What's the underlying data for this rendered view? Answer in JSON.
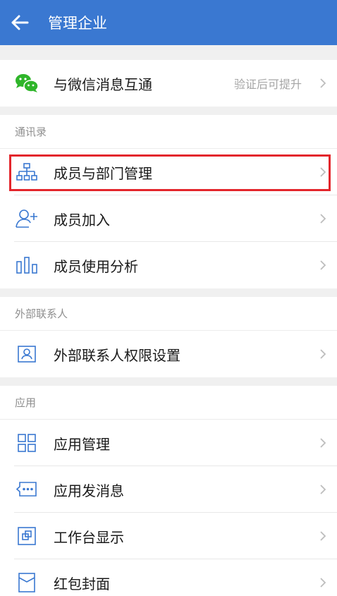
{
  "header": {
    "title": "管理企业"
  },
  "top": {
    "label": "与微信消息互通",
    "hint": "验证后可提升"
  },
  "contacts": {
    "section": "通讯录",
    "items": [
      {
        "label": "成员与部门管理",
        "icon": "org-chart-icon"
      },
      {
        "label": "成员加入",
        "icon": "add-member-icon"
      },
      {
        "label": "成员使用分析",
        "icon": "bar-chart-icon"
      }
    ]
  },
  "external": {
    "section": "外部联系人",
    "items": [
      {
        "label": "外部联系人权限设置",
        "icon": "contact-card-icon"
      }
    ]
  },
  "apps": {
    "section": "应用",
    "items": [
      {
        "label": "应用管理",
        "icon": "app-grid-icon"
      },
      {
        "label": "应用发消息",
        "icon": "message-icon"
      },
      {
        "label": "工作台显示",
        "icon": "workbench-icon"
      },
      {
        "label": "红包封面",
        "icon": "red-packet-icon"
      }
    ]
  },
  "colors": {
    "header": "#3a78d1",
    "icon": "#3a78d1",
    "highlight": "#e3262c",
    "wechat": "#2fb52a"
  }
}
